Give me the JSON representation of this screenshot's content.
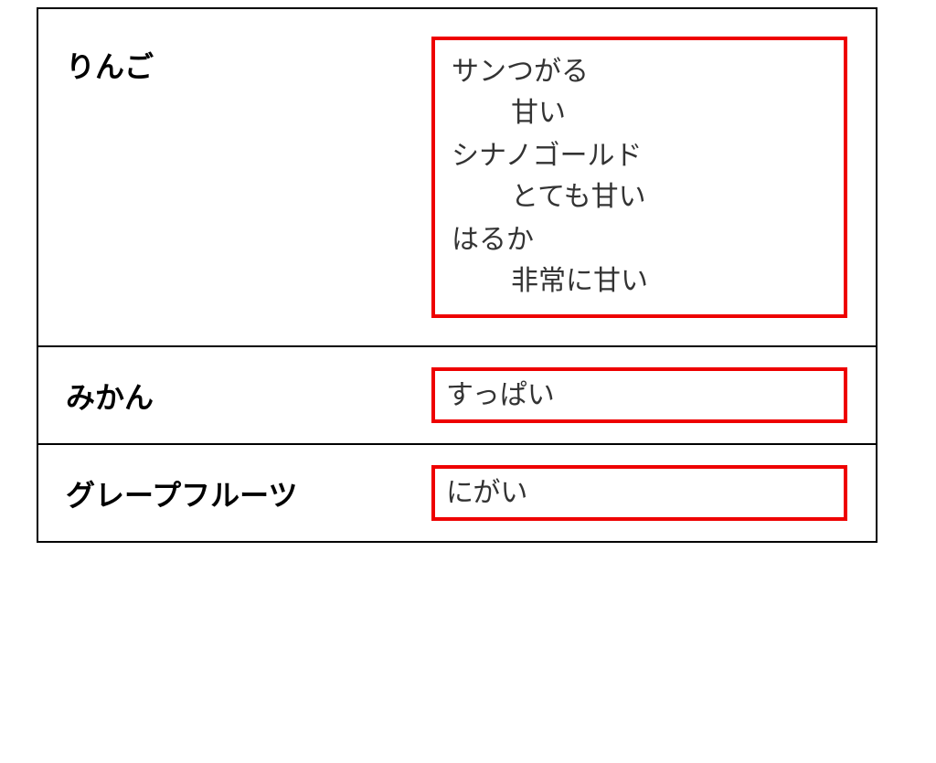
{
  "rows": [
    {
      "label": "りんご",
      "type": "list",
      "items": [
        {
          "name": "サンつがる",
          "desc": "甘い"
        },
        {
          "name": "シナノゴールド",
          "desc": "とても甘い"
        },
        {
          "name": "はるか",
          "desc": "非常に甘い"
        }
      ]
    },
    {
      "label": "みかん",
      "type": "text",
      "value": "すっぱい"
    },
    {
      "label": "グレープフルーツ",
      "type": "text",
      "value": "にがい"
    }
  ]
}
